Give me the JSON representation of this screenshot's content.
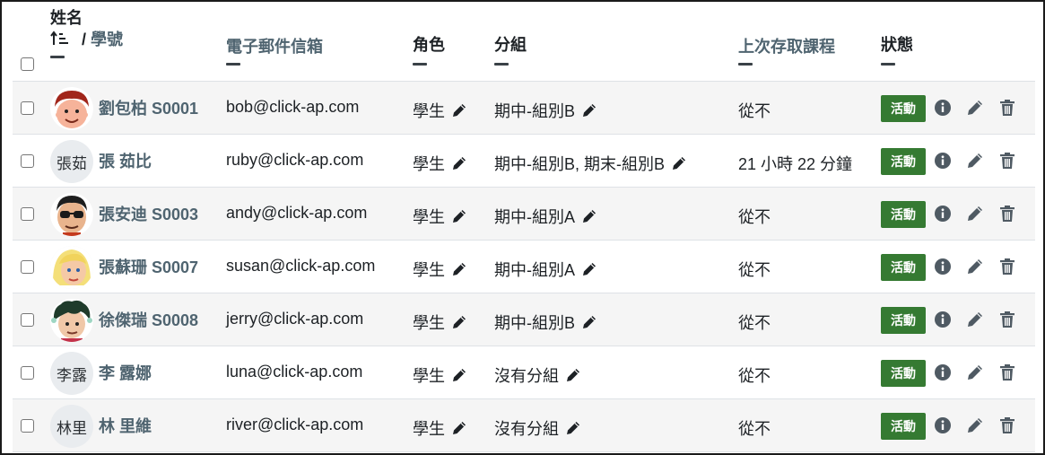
{
  "header": {
    "col_name_top": "姓名",
    "col_name_sort_icon": "sort-ascending-icon",
    "col_name_sep": "/",
    "col_id": "學號",
    "col_email": "電子郵件信箱",
    "col_role": "角色",
    "col_group": "分組",
    "col_lastaccess": "上次存取課程",
    "col_status": "狀態"
  },
  "colors": {
    "link": "#4f6470",
    "status_active": "#357a32",
    "row_stripe": "#f5f5f5"
  },
  "rows": [
    {
      "name": "劉包柏 S0001",
      "avatar": "avatar-photo",
      "initials": "",
      "email": "bob@click-ap.com",
      "role": "學生",
      "group": "期中-組別B",
      "lastaccess": "從不",
      "status": "活動"
    },
    {
      "name": "張 茹比",
      "avatar": "avatar-initials",
      "initials": "張茹",
      "email": "ruby@click-ap.com",
      "role": "學生",
      "group": "期中-組別B, 期末-組別B",
      "lastaccess": "21 小時 22 分鐘",
      "status": "活動"
    },
    {
      "name": "張安迪 S0003",
      "avatar": "avatar-photo",
      "initials": "",
      "email": "andy@click-ap.com",
      "role": "學生",
      "group": "期中-組別A",
      "lastaccess": "從不",
      "status": "活動"
    },
    {
      "name": "張蘇珊 S0007",
      "avatar": "avatar-photo",
      "initials": "",
      "email": "susan@click-ap.com",
      "role": "學生",
      "group": "期中-組別A",
      "lastaccess": "從不",
      "status": "活動"
    },
    {
      "name": "徐傑瑞 S0008",
      "avatar": "avatar-photo",
      "initials": "",
      "email": "jerry@click-ap.com",
      "role": "學生",
      "group": "期中-組別B",
      "lastaccess": "從不",
      "status": "活動"
    },
    {
      "name": "李 露娜",
      "avatar": "avatar-initials",
      "initials": "李露",
      "email": "luna@click-ap.com",
      "role": "學生",
      "group": "沒有分組",
      "lastaccess": "從不",
      "status": "活動"
    },
    {
      "name": "林 里維",
      "avatar": "avatar-initials",
      "initials": "林里",
      "email": "river@click-ap.com",
      "role": "學生",
      "group": "沒有分組",
      "lastaccess": "從不",
      "status": "活動"
    }
  ]
}
